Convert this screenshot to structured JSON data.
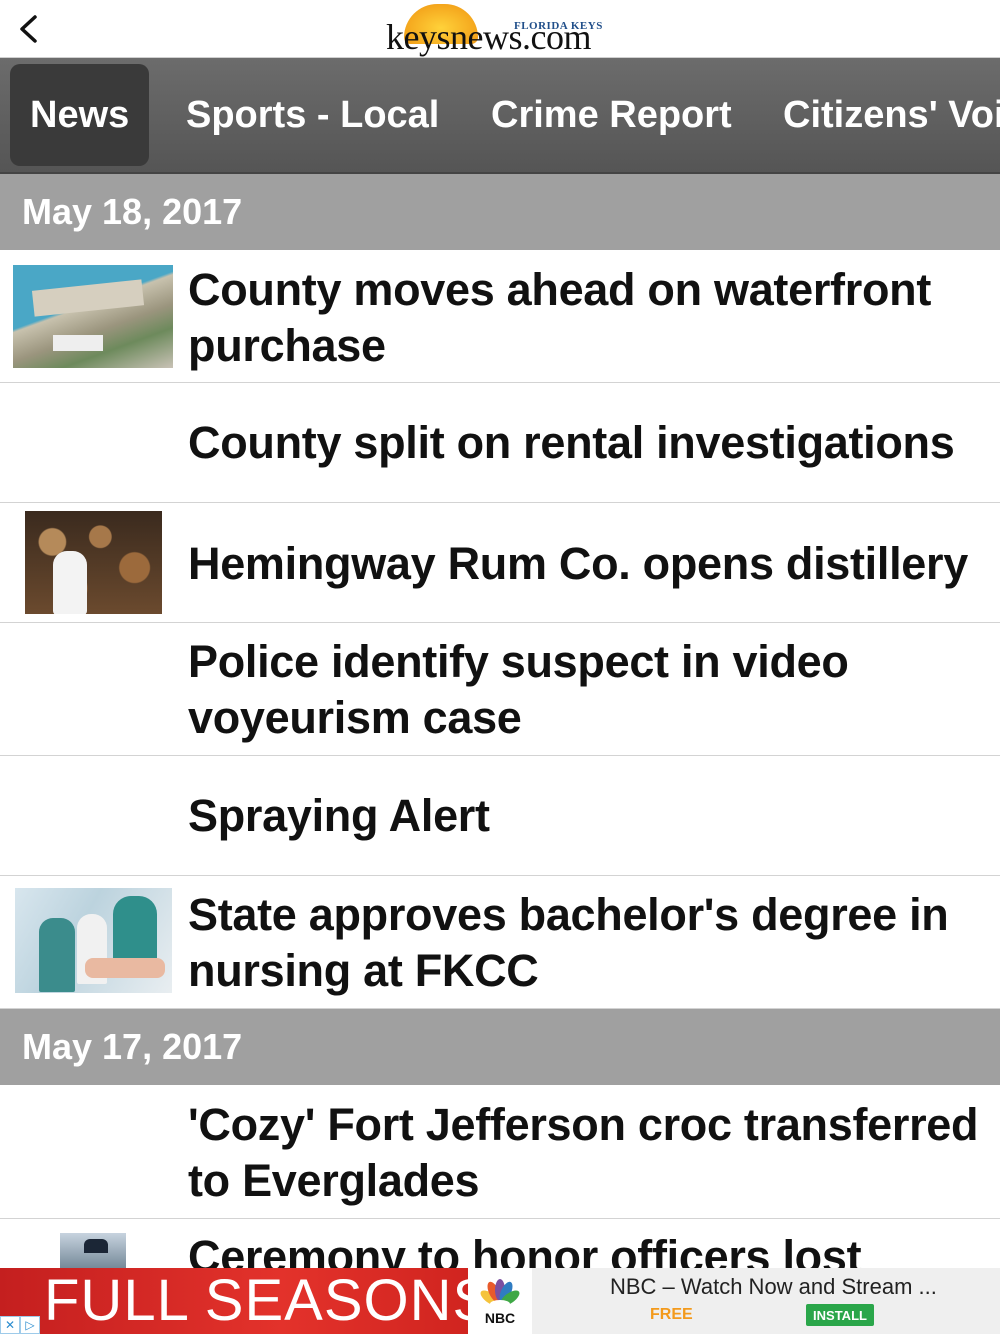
{
  "header": {
    "back_icon": "chevron-left-icon",
    "logo_text": "keysnews.com",
    "logo_tag": "FLORIDA KEYS"
  },
  "tabs": [
    {
      "label": "News",
      "active": true
    },
    {
      "label": "Sports - Local",
      "active": false
    },
    {
      "label": "Crime Report",
      "active": false
    },
    {
      "label": "Citizens' Voi",
      "active": false
    }
  ],
  "sections": [
    {
      "date": "May 18, 2017",
      "articles": [
        {
          "title": "County moves ahead on waterfront purchase",
          "has_thumbnail": true
        },
        {
          "title": "County split on rental investigations",
          "has_thumbnail": false
        },
        {
          "title": "Hemingway Rum Co. opens distillery",
          "has_thumbnail": true
        },
        {
          "title": "Police identify suspect in video voyeurism case",
          "has_thumbnail": false
        },
        {
          "title": "Spraying Alert",
          "has_thumbnail": false
        },
        {
          "title": "State approves bachelor's degree in nursing at FKCC",
          "has_thumbnail": true
        }
      ]
    },
    {
      "date": "May 17, 2017",
      "articles": [
        {
          "title": "'Cozy' Fort Jefferson croc transferred to Everglades",
          "has_thumbnail": false
        },
        {
          "title": "Ceremony to honor officers lost",
          "has_thumbnail": true
        }
      ]
    }
  ],
  "ad": {
    "banner_text": "FULL SEASONS",
    "brand_logo_text": "NBC",
    "app_title": "NBC – Watch Now and Stream ...",
    "price": "FREE",
    "install_label": "INSTALL",
    "colors": {
      "banner": "#e3322b",
      "install": "#2aa64a",
      "free": "#f39a1c"
    }
  },
  "colors": {
    "tab_bar": "#5f5f5f",
    "date_header": "#a0a0a0"
  }
}
